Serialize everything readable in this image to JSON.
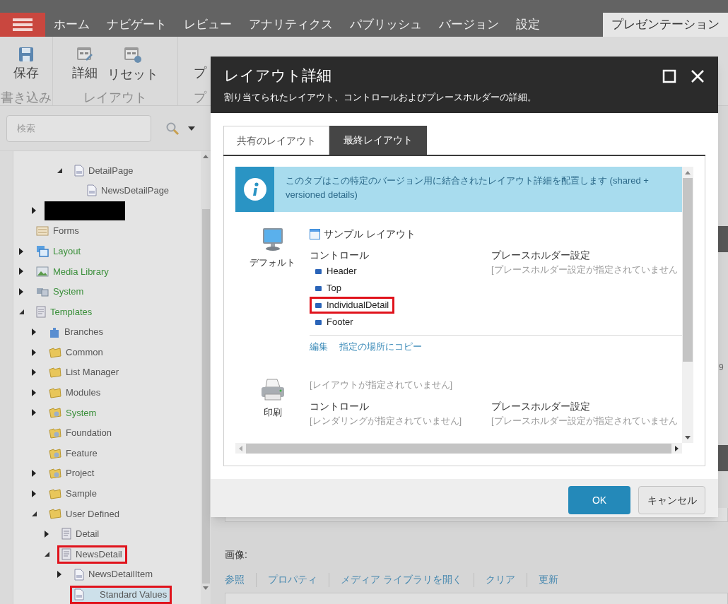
{
  "nav_tabs": [
    {
      "label": "ホーム",
      "selected": false
    },
    {
      "label": "ナビゲート",
      "selected": false
    },
    {
      "label": "レビュー",
      "selected": false
    },
    {
      "label": "アナリティクス",
      "selected": false
    },
    {
      "label": "パブリッシュ",
      "selected": false
    },
    {
      "label": "バージョン",
      "selected": false
    },
    {
      "label": "設定",
      "selected": false
    },
    {
      "label": "プレゼンテーション",
      "selected": true
    }
  ],
  "ribbon": [
    {
      "label": "書き込み",
      "buttons": [
        {
          "label": "保存",
          "kind": "save"
        }
      ]
    },
    {
      "label": "レイアウト",
      "buttons": [
        {
          "label": "詳細",
          "kind": "details"
        },
        {
          "label": "リセット",
          "kind": "reset"
        }
      ]
    },
    {
      "label": "プ",
      "buttons": [
        {
          "label": "プ",
          "kind": "plain"
        }
      ]
    }
  ],
  "search": {
    "placeholder": "検索"
  },
  "tree": [
    {
      "children": [
        {
          "children": [
            {
              "children": [
                {
                  "label": "DetailPage",
                  "kind": "page",
                  "expanded": true,
                  "selected": false,
                  "outlined": false,
                  "color": "#555555",
                  "children": [
                    {
                      "label": "NewsDetailPage",
                      "kind": "page",
                      "selected": false,
                      "outlined": false,
                      "color": "#555555"
                    }
                  ]
                }
              ]
            }
          ]
        },
        {
          "kind": "redacted",
          "expanded": false
        }
      ]
    },
    {
      "label": "Forms",
      "kind": "form",
      "selected": false,
      "outlined": false,
      "color": "#555555"
    },
    {
      "label": "Layout",
      "kind": "layout",
      "expanded": false,
      "selected": false,
      "outlined": false,
      "color": "#3a8f3a"
    },
    {
      "label": "Media Library",
      "kind": "media",
      "expanded": false,
      "selected": false,
      "outlined": false,
      "color": "#3a8f3a"
    },
    {
      "label": "System",
      "kind": "system",
      "expanded": false,
      "selected": false,
      "outlined": false,
      "color": "#3a8f3a"
    },
    {
      "label": "Templates",
      "kind": "template",
      "expanded": true,
      "selected": false,
      "outlined": false,
      "color": "#3a8f3a",
      "children": [
        {
          "label": "Branches",
          "kind": "branch",
          "expanded": false,
          "selected": false,
          "outlined": false,
          "color": "#555555"
        },
        {
          "label": "Common",
          "kind": "folder",
          "expanded": false,
          "selected": false,
          "outlined": false,
          "color": "#555555"
        },
        {
          "label": "List Manager",
          "kind": "folder",
          "expanded": false,
          "selected": false,
          "outlined": false,
          "color": "#555555"
        },
        {
          "label": "Modules",
          "kind": "folder",
          "expanded": false,
          "selected": false,
          "outlined": false,
          "color": "#555555"
        },
        {
          "label": "System",
          "kind": "special-folder",
          "expanded": false,
          "selected": false,
          "outlined": false,
          "color": "#3a8f3a"
        },
        {
          "label": "Foundation",
          "kind": "special-folder",
          "selected": false,
          "outlined": false,
          "color": "#555555"
        },
        {
          "label": "Feature",
          "kind": "special-folder",
          "selected": false,
          "outlined": false,
          "color": "#555555"
        },
        {
          "label": "Project",
          "kind": "special-folder",
          "expanded": false,
          "selected": false,
          "outlined": false,
          "color": "#555555"
        },
        {
          "label": "Sample",
          "kind": "folder",
          "expanded": false,
          "selected": false,
          "outlined": false,
          "color": "#555555"
        },
        {
          "label": "User Defined",
          "kind": "folder",
          "expanded": true,
          "selected": false,
          "outlined": false,
          "color": "#555555",
          "children": [
            {
              "label": "Detail",
              "kind": "template",
              "expanded": false,
              "selected": false,
              "outlined": false,
              "color": "#555555"
            },
            {
              "label": "NewsDetail",
              "kind": "template",
              "expanded": true,
              "selected": false,
              "outlined": true,
              "color": "#555555",
              "children": [
                {
                  "label": "NewsDetailItem",
                  "kind": "page",
                  "expanded": false,
                  "selected": false,
                  "outlined": false,
                  "color": "#555555"
                },
                {
                  "label": "Standard Values",
                  "kind": "page",
                  "selected": true,
                  "outlined": true,
                  "color": "#555555"
                }
              ]
            }
          ]
        }
      ]
    }
  ],
  "right_edge": {
    "text": "9"
  },
  "image_field": {
    "label": "画像:",
    "links": [
      "参照",
      "プロパティ",
      "メディア ライブラリを開く",
      "クリア",
      "更新"
    ]
  },
  "dialog": {
    "title": "レイアウト詳細",
    "subtitle": "割り当てられたレイアウト、コントロールおよびプレースホルダーの詳細。",
    "tabs": [
      {
        "label": "共有のレイアウト",
        "selected": false
      },
      {
        "label": "最終レイアウト",
        "selected": true
      }
    ],
    "info": "このタブはこの特定のバージョン用に結合されたレイアウト詳細を配置します (shared + versioned details)",
    "devices": [
      {
        "name": "デフォルト",
        "kind": "monitor",
        "layout": {
          "text": "サンプル レイアウト",
          "assigned": true
        },
        "controls_heading": "コントロール",
        "controls": [
          {
            "label": "Header",
            "outlined": false
          },
          {
            "label": "Top",
            "outlined": false
          },
          {
            "label": "IndividualDetail",
            "outlined": true
          },
          {
            "label": "Footer",
            "outlined": false
          }
        ],
        "placeholders_heading": "プレースホルダー設定",
        "placeholders_note": "[プレースホルダー設定が指定されていません",
        "links": [
          "編集",
          "指定の場所にコピー"
        ]
      },
      {
        "name": "印刷",
        "kind": "printer",
        "layout": {
          "text": "[レイアウトが指定されていません]",
          "assigned": false
        },
        "controls_heading": "コントロール",
        "controls_note": "[レンダリングが指定されていません]",
        "placeholders_heading": "プレースホルダー設定",
        "placeholders_note": "[プレースホルダー設定が指定されていません"
      }
    ],
    "buttons": [
      {
        "label": "OK",
        "kind": "primary"
      },
      {
        "label": "キャンセル",
        "kind": "secondary"
      }
    ]
  }
}
